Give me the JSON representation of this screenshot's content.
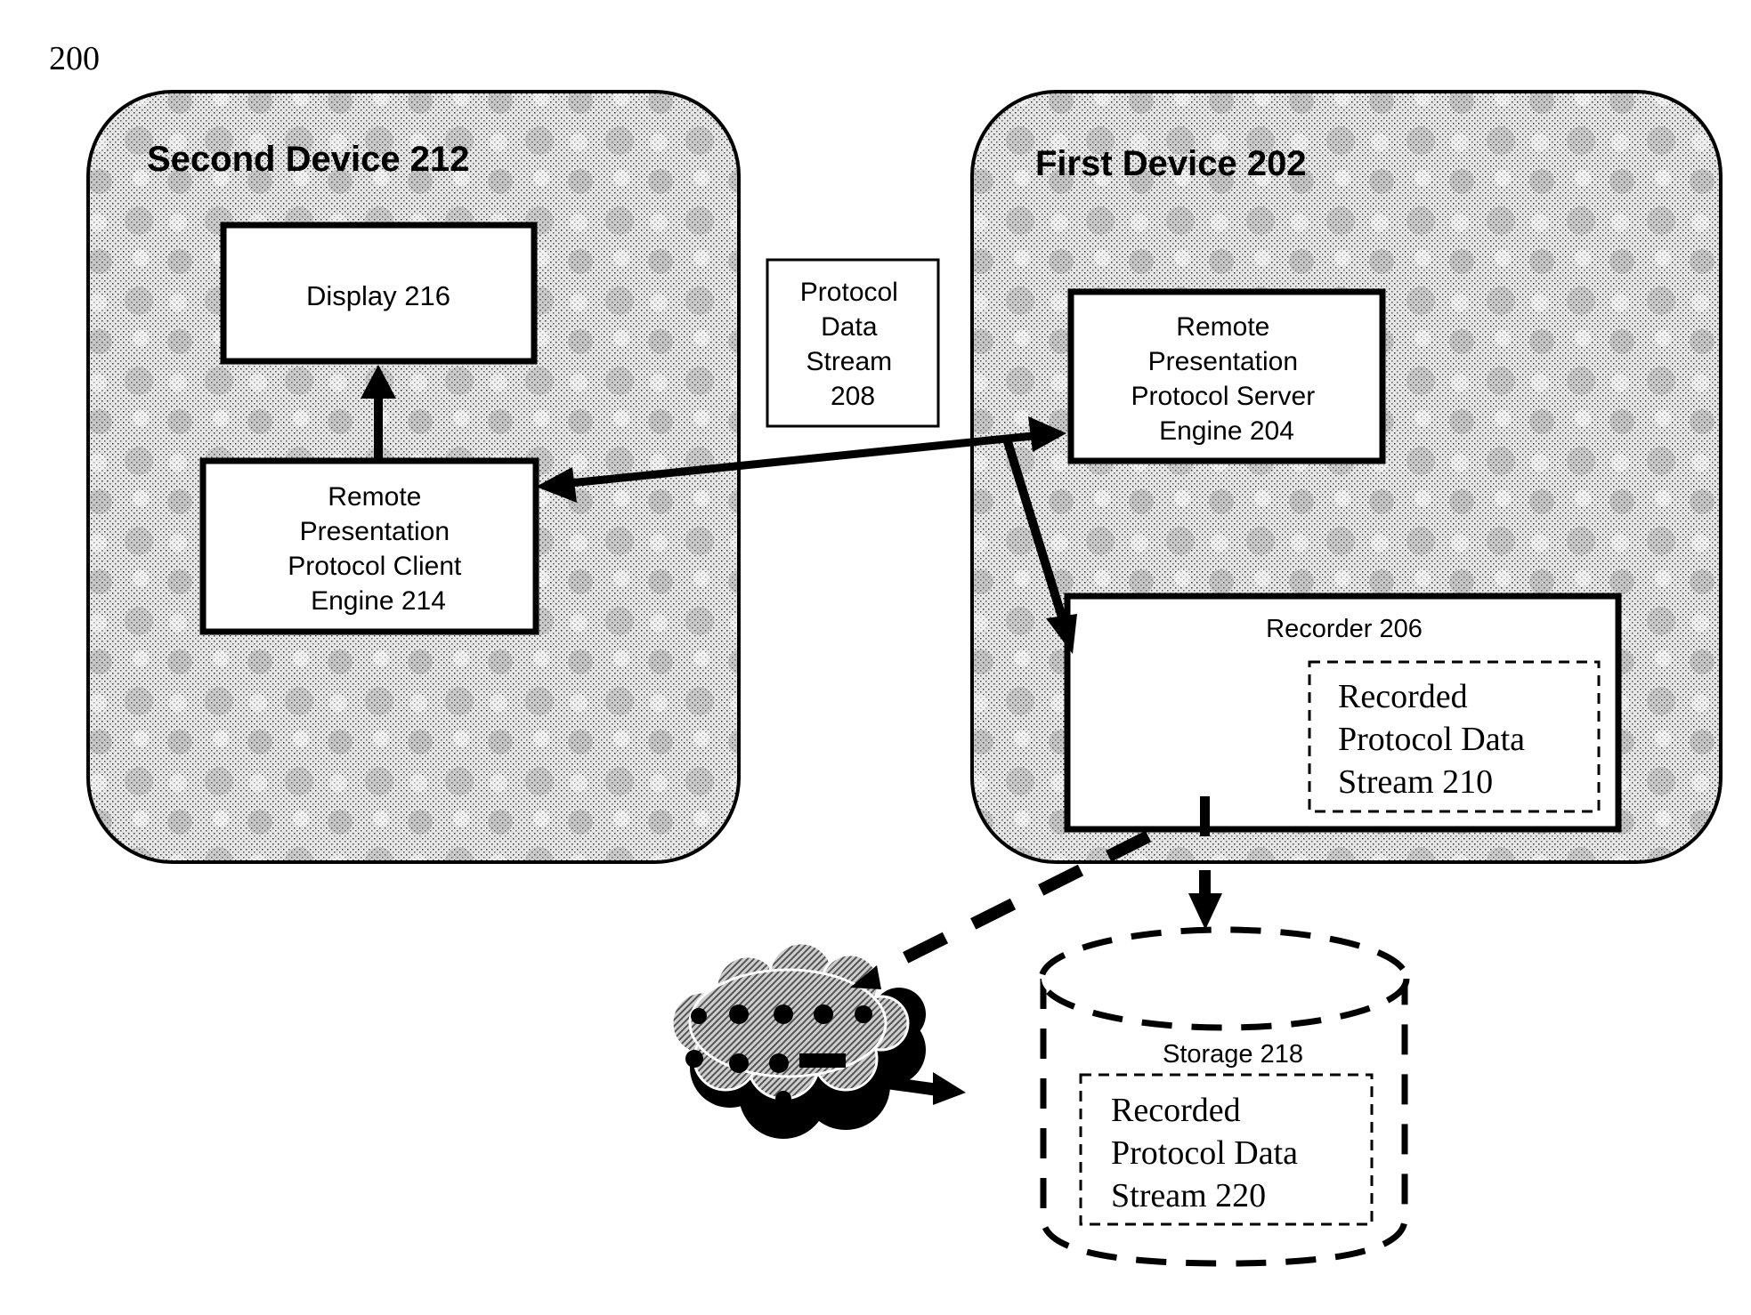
{
  "figure_label": "200",
  "second_device": {
    "title": "Second Device 212",
    "display": {
      "label": "Display 216"
    },
    "client_engine": {
      "lines": [
        "Remote",
        "Presentation",
        "Protocol Client",
        "Engine 214"
      ]
    }
  },
  "protocol_stream": {
    "lines": [
      "Protocol",
      "Data",
      "Stream",
      "208"
    ]
  },
  "first_device": {
    "title": "First Device 202",
    "server_engine": {
      "lines": [
        "Remote",
        "Presentation",
        "Protocol Server",
        "Engine 204"
      ]
    },
    "recorder": {
      "label": "Recorder 206",
      "recorded_stream": {
        "lines": [
          "Recorded",
          "Protocol Data",
          "Stream 210"
        ]
      }
    }
  },
  "network": {
    "icon": "network-cloud-icon"
  },
  "storage": {
    "label": "Storage 218",
    "recorded_stream": {
      "lines": [
        "Recorded",
        "Protocol Data",
        "Stream 220"
      ]
    }
  },
  "colors": {
    "ink": "#000000",
    "paper": "#ffffff",
    "device_fill": "#d9d9d9"
  }
}
